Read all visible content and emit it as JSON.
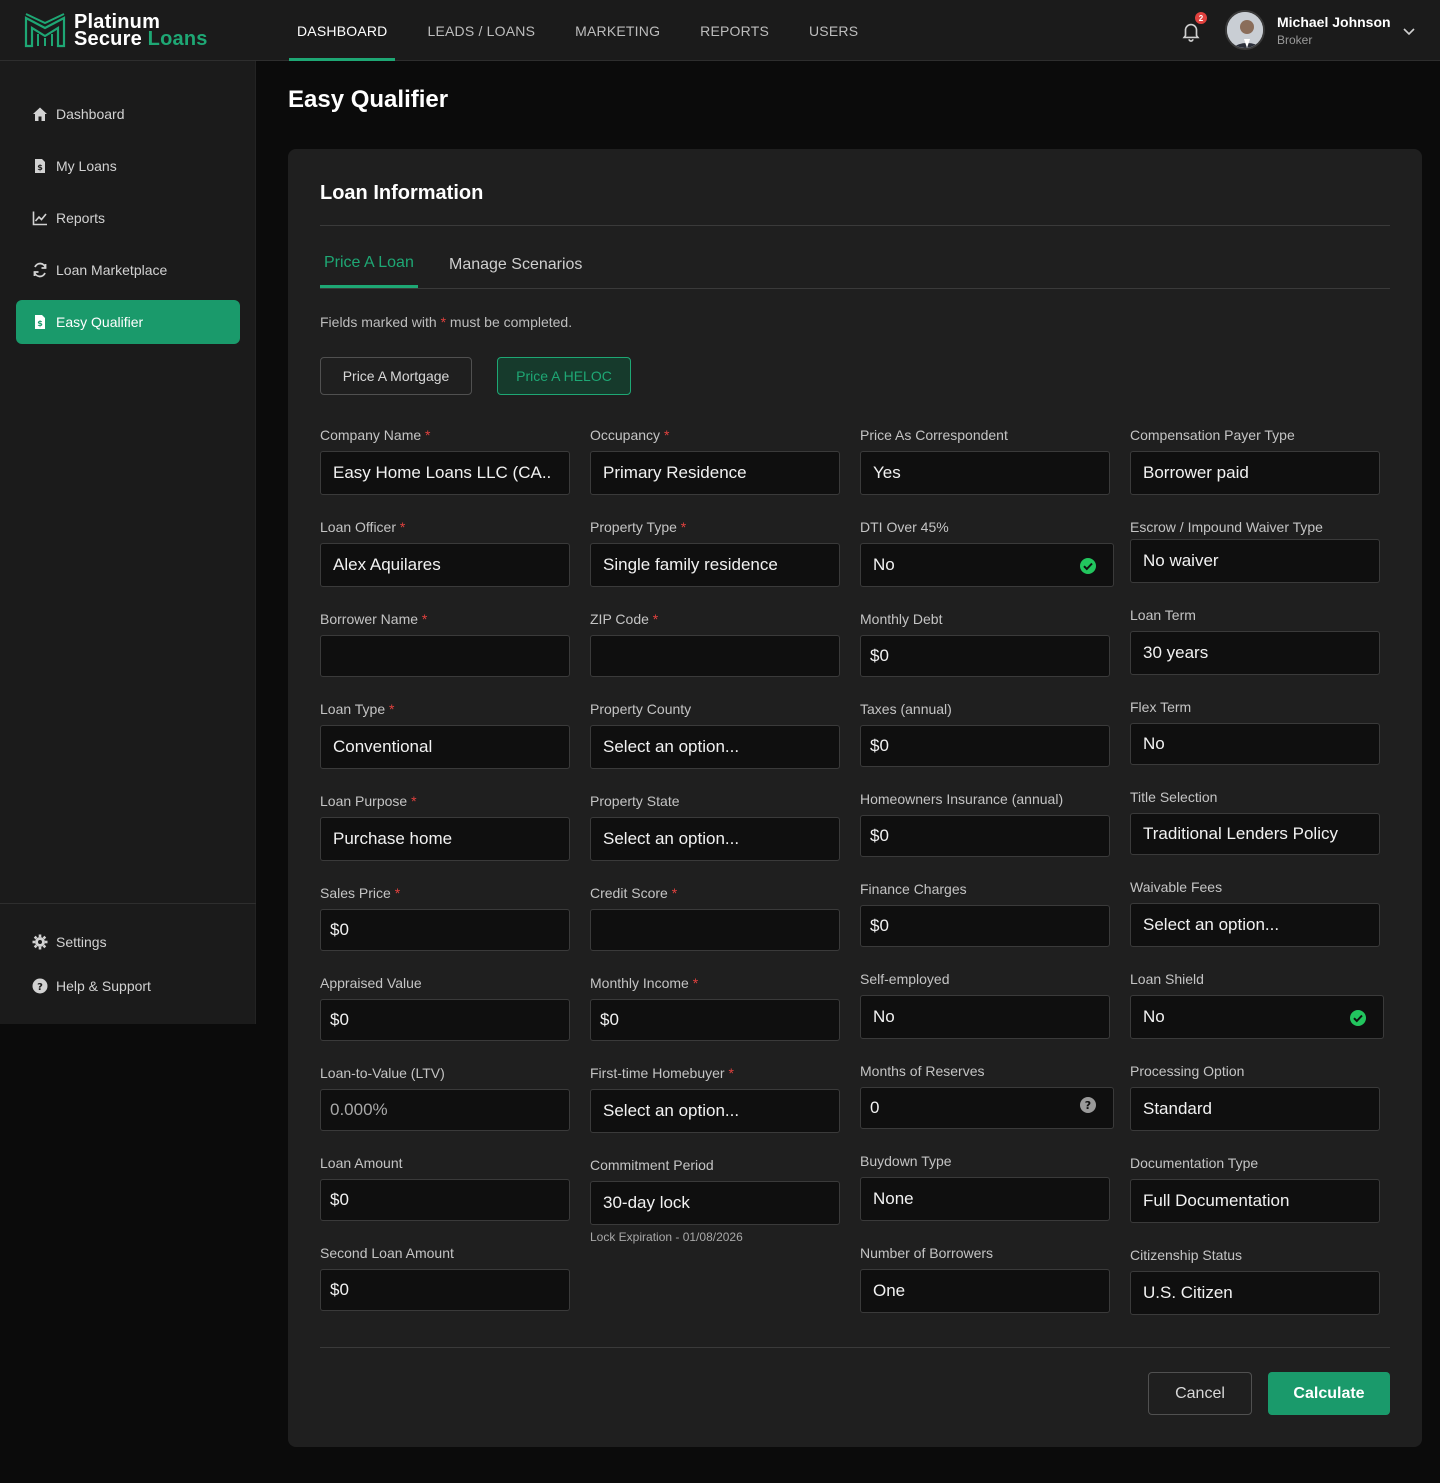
{
  "brand": {
    "line1": "Platinum",
    "line2a": "Secure ",
    "line2b": "Loans"
  },
  "nav": [
    "DASHBOARD",
    "LEADS / LOANS",
    "MARKETING",
    "REPORTS",
    "USERS"
  ],
  "notifications": {
    "count": "2"
  },
  "user": {
    "name": "Michael Johnson",
    "role": "Broker"
  },
  "sidebar": {
    "items": [
      "Dashboard",
      "My Loans",
      "Reports",
      "Loan Marketplace",
      "Easy Qualifier"
    ],
    "bottom": [
      "Settings",
      "Help & Support"
    ]
  },
  "page": {
    "title": "Easy Qualifier"
  },
  "card": {
    "title": "Loan Information",
    "tabs": [
      "Price A Loan",
      "Manage Scenarios"
    ],
    "note_before": "Fields marked with ",
    "note_star": "*",
    "note_after": " must be completed.",
    "mode_buttons": [
      "Price A Mortgage",
      "Price A HELOC"
    ]
  },
  "form": {
    "col1": [
      {
        "label": "Company Name",
        "req": "*",
        "value": "Easy Home Loans LLC (CA.."
      },
      {
        "label": "Loan Officer",
        "req": "*",
        "value": "Alex Aquilares"
      },
      {
        "label": "Borrower Name",
        "req": "*",
        "value": ""
      },
      {
        "label": "Loan Type",
        "req": "*",
        "value": "Conventional"
      },
      {
        "label": "Loan Purpose",
        "req": "*",
        "value": "Purchase home"
      },
      {
        "label": "Sales Price",
        "req": "*",
        "value": "$0"
      },
      {
        "label": "Appraised Value",
        "req": "",
        "value": "$0"
      },
      {
        "label": "Loan-to-Value (LTV)",
        "req": "",
        "value": "0.000%"
      },
      {
        "label": "Loan Amount",
        "req": "",
        "value": "$0"
      },
      {
        "label": "Second Loan Amount",
        "req": "",
        "value": "$0"
      }
    ],
    "col2": [
      {
        "label": "Occupancy",
        "req": "*",
        "value": "Primary Residence"
      },
      {
        "label": "Property Type",
        "req": "*",
        "value": "Single family residence"
      },
      {
        "label": "ZIP Code",
        "req": "*",
        "value": ""
      },
      {
        "label": "Property County",
        "req": "",
        "value": "Select an option..."
      },
      {
        "label": "Property State",
        "req": "",
        "value": "Select an option..."
      },
      {
        "label": "Credit Score",
        "req": "*",
        "value": ""
      },
      {
        "label": "Monthly Income",
        "req": "*",
        "value": "$0"
      },
      {
        "label": "First-time Homebuyer",
        "req": "*",
        "value": "Select an option..."
      },
      {
        "label": "Commitment Period",
        "req": "",
        "value": "30-day lock",
        "note": "Lock Expiration - 01/08/2026"
      }
    ],
    "col3": [
      {
        "label": "Price As Correspondent",
        "value": "Yes"
      },
      {
        "label": "DTI Over 45%",
        "value": "No"
      },
      {
        "label": "Monthly Debt",
        "value": "$0"
      },
      {
        "label": "Taxes (annual)",
        "value": "$0"
      },
      {
        "label": "Homeowners Insurance (annual)",
        "value": "$0"
      },
      {
        "label": "Finance Charges",
        "value": "$0"
      },
      {
        "label": "Self-employed",
        "value": "No"
      },
      {
        "label": "Months of Reserves",
        "value": "0"
      },
      {
        "label": "Buydown Type",
        "value": "None"
      },
      {
        "label": "Number of Borrowers",
        "value": "One"
      }
    ],
    "col4": [
      {
        "label": "Compensation Payer Type",
        "value": "Borrower paid"
      },
      {
        "label": "Escrow / Impound Waiver Type",
        "value": "No waiver"
      },
      {
        "label": "Loan Term",
        "value": "30 years"
      },
      {
        "label": "Flex Term",
        "value": "No"
      },
      {
        "label": "Title Selection",
        "value": "Traditional Lenders Policy"
      },
      {
        "label": "Waivable Fees",
        "value": "Select an option..."
      },
      {
        "label": "Loan Shield",
        "value": "No"
      },
      {
        "label": "Processing Option",
        "value": "Standard"
      },
      {
        "label": "Documentation Type",
        "value": "Full Documentation"
      },
      {
        "label": "Citizenship Status",
        "value": "U.S. Citizen"
      }
    ]
  },
  "actions": {
    "cancel": "Cancel",
    "calculate": "Calculate"
  },
  "colors": {
    "accent": "#1ea774",
    "accent_btn": "#1a9a6b",
    "required": "#e0413e",
    "background": "#0b0b0b",
    "panel": "#1f1f1f"
  }
}
